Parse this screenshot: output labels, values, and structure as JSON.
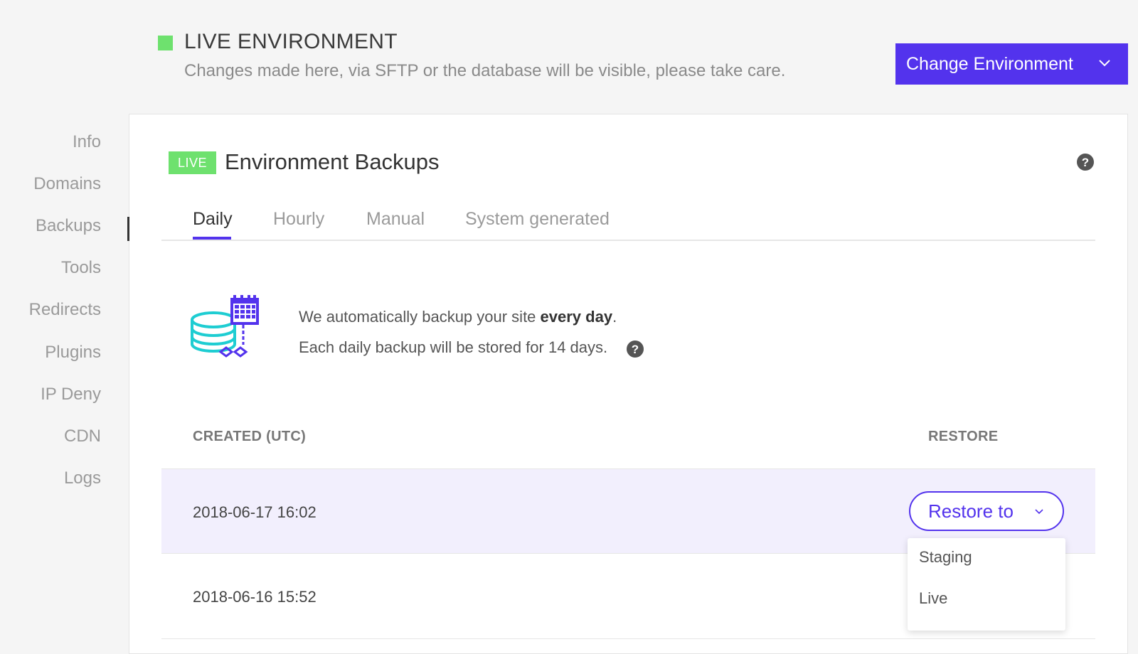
{
  "colors": {
    "accent": "#5333ed",
    "live_green": "#6ee16e",
    "teal": "#1ecdd2",
    "help_icon": "#555555"
  },
  "header": {
    "env_title": "LIVE ENVIRONMENT",
    "env_subtitle": "Changes made here, via SFTP or the database will be visible, please take care.",
    "change_env_label": "Change Environment",
    "change_env_icon": "chevron-down-icon"
  },
  "sidebar": {
    "items": [
      {
        "label": "Info"
      },
      {
        "label": "Domains"
      },
      {
        "label": "Backups",
        "active": true
      },
      {
        "label": "Tools"
      },
      {
        "label": "Redirects"
      },
      {
        "label": "Plugins"
      },
      {
        "label": "IP Deny"
      },
      {
        "label": "CDN"
      },
      {
        "label": "Logs"
      }
    ]
  },
  "panel": {
    "badge": "LIVE",
    "title": "Environment Backups",
    "help_icon": "question-circle-icon"
  },
  "tabs": [
    {
      "label": "Daily",
      "active": true
    },
    {
      "label": "Hourly"
    },
    {
      "label": "Manual"
    },
    {
      "label": "System generated"
    }
  ],
  "info": {
    "line1_prefix": "We automatically backup your site ",
    "line1_bold": "every day",
    "line1_suffix": ".",
    "line2": "Each daily backup will be stored for 14 days.",
    "illustration": "database-calendar-icon"
  },
  "table": {
    "headers": {
      "created": "CREATED (UTC)",
      "restore": "RESTORE"
    },
    "rows": [
      {
        "created": "2018-06-17 16:02"
      },
      {
        "created": "2018-06-16 15:52"
      }
    ]
  },
  "restore": {
    "label": "Restore to",
    "options": [
      "Staging",
      "Live"
    ]
  }
}
